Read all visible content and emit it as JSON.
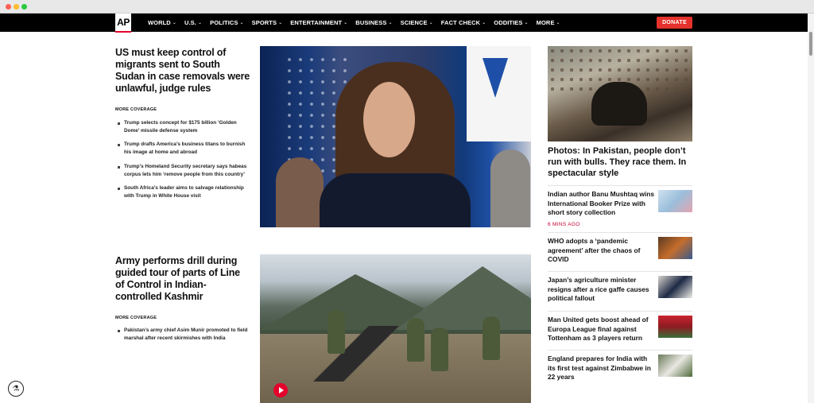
{
  "nav": {
    "logo": "AP",
    "items": [
      {
        "label": "WORLD"
      },
      {
        "label": "U.S."
      },
      {
        "label": "POLITICS"
      },
      {
        "label": "SPORTS"
      },
      {
        "label": "ENTERTAINMENT"
      },
      {
        "label": "BUSINESS"
      },
      {
        "label": "SCIENCE"
      },
      {
        "label": "FACT CHECK"
      },
      {
        "label": "ODDITIES"
      },
      {
        "label": "MORE"
      }
    ],
    "donate_label": "DONATE"
  },
  "story1": {
    "headline": "US must keep control of migrants sent to South Sudan in case removals were unlawful, judge rules",
    "more_coverage": "MORE COVERAGE",
    "coverage": [
      "Trump selects concept for $175 billion ‘Golden Dome’ missile defense system",
      "Trump drafts America’s business titans to burnish his image at home and abroad",
      "Trump’s Homeland Security secretary says habeas corpus lets him ‘remove people from this country’",
      "South Africa’s leader aims to salvage relationship with Trump in White House visit"
    ]
  },
  "story2": {
    "headline": "Army performs drill during guided tour of parts of Line of Control in Indian-controlled Kashmir",
    "more_coverage": "MORE COVERAGE",
    "coverage": [
      "Pakistan’s army chief Asim Munir promoted to field marshal after recent skirmishes with India"
    ]
  },
  "sidebar": {
    "feature_headline": "Photos: In Pakistan, people don’t run with bulls. They race them. In spectacular style",
    "items": [
      {
        "headline": "Indian author Banu Mushtaq wins International Booker Prize with short story collection",
        "time": "6 MINS AGO"
      },
      {
        "headline": "WHO adopts a ‘pandemic agreement’ after the chaos of COVID"
      },
      {
        "headline": "Japan’s agriculture minister resigns after a rice gaffe causes political fallout"
      },
      {
        "headline": "Man United gets boost ahead of Europa League final against Tottenham as 3 players return"
      },
      {
        "headline": "England prepares for India with its first test against Zimbabwe in 22 years"
      }
    ]
  },
  "colors": {
    "accent": "#e4002b",
    "donate": "#e4312b",
    "nav_bg": "#000000",
    "timestamp": "#c2002f"
  }
}
